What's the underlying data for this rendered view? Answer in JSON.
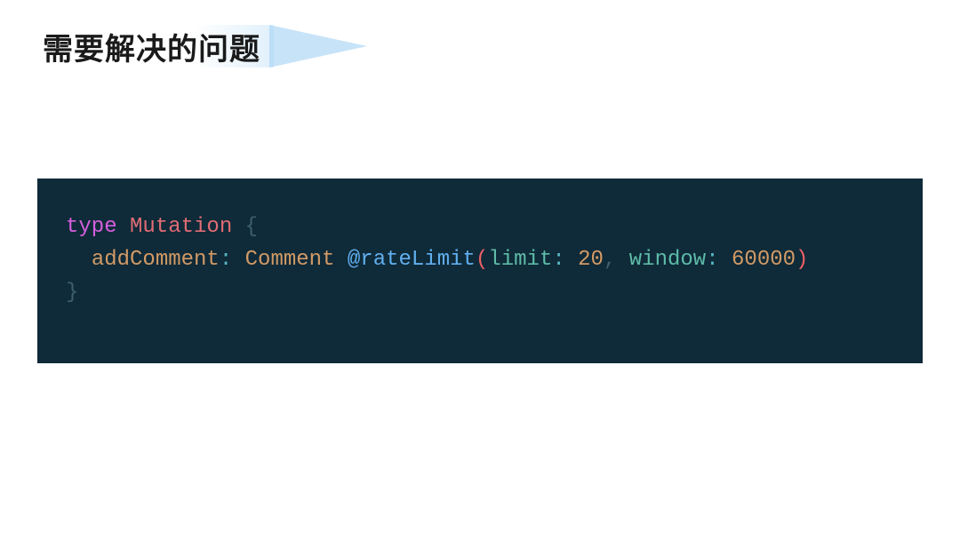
{
  "slide": {
    "title": "需要解决的问题"
  },
  "code": {
    "tokens": {
      "kw_type": "type",
      "type_name": "Mutation",
      "brace_open": "{",
      "field": "addComment",
      "colon1": ":",
      "return_type": "Comment",
      "directive": "@rateLimit",
      "paren_open": "(",
      "param_limit": "limit",
      "colon2": ":",
      "val_limit": "20",
      "comma": ",",
      "param_window": "window",
      "colon3": ":",
      "val_window": "60000",
      "paren_close": ")",
      "brace_close": "}"
    }
  }
}
